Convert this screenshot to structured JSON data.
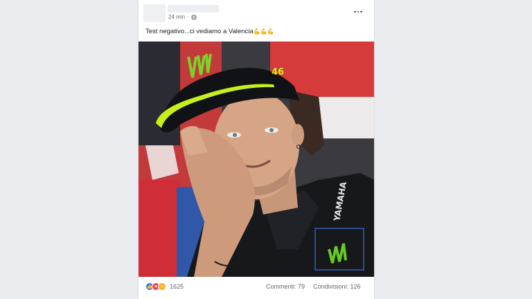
{
  "post": {
    "timestamp": "24 min",
    "privacy_icon": "globe-icon",
    "text": "Test negativo...ci vediamo a Valencia",
    "emoji": "💪💪💪",
    "more_icon": "more-horizontal-icon"
  },
  "footer": {
    "reaction_icons": [
      "like-icon",
      "love-icon",
      "care-icon"
    ],
    "reaction_count": "1625",
    "comments": "Commenti: 79",
    "shares": "Condivisioni: 126"
  },
  "photo": {
    "cap_logo_text": "46",
    "shirt_brand_text": "YAMAHA"
  },
  "colors": {
    "page_background": "#e9ebee",
    "card_background": "#ffffff",
    "accent": "#1877f2",
    "cap_neon": "#c6f01a"
  }
}
